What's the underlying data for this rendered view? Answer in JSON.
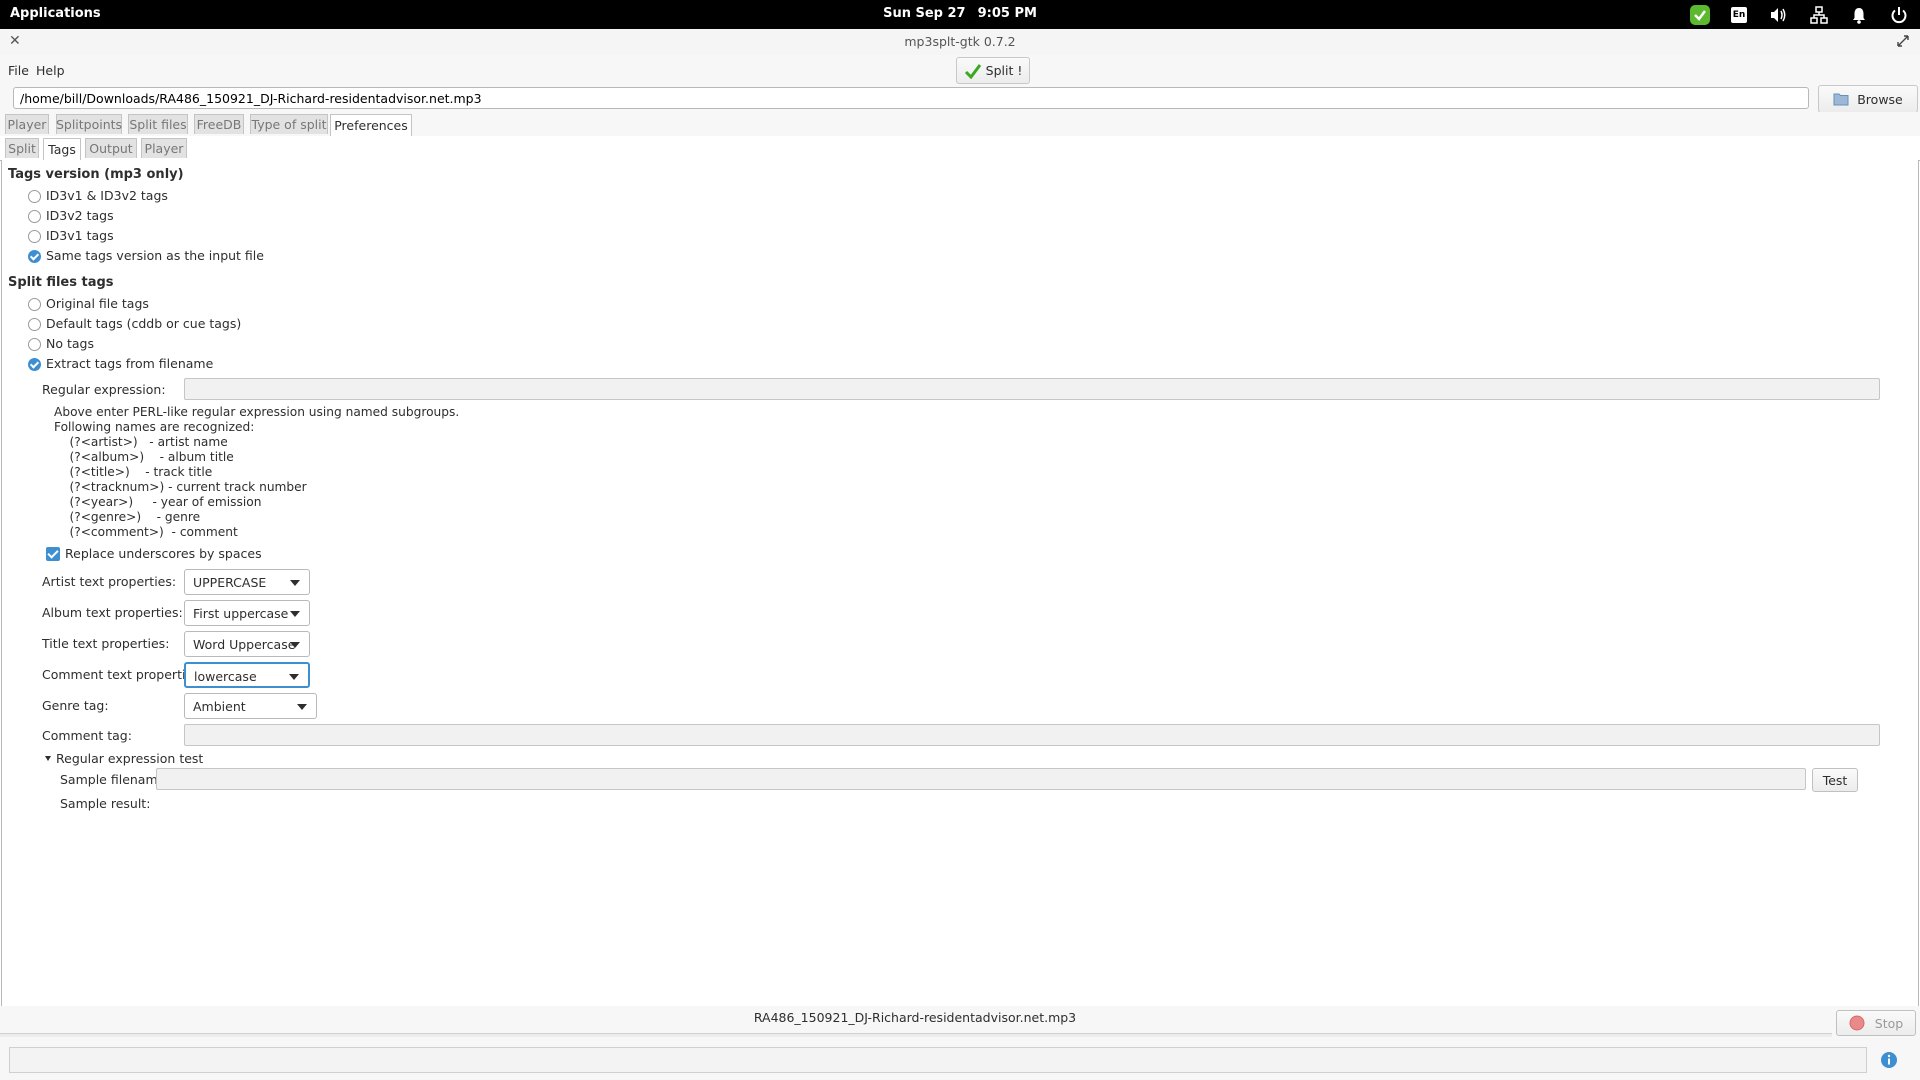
{
  "topbar": {
    "applications": "Applications",
    "date": "Sun Sep 27",
    "time": "9:05 PM",
    "keyboard": "En"
  },
  "window": {
    "title": "mp3splt-gtk 0.7.2"
  },
  "menu": {
    "file": "File",
    "help": "Help",
    "split_button": "Split !"
  },
  "path": {
    "value": "/home/bill/Downloads/RA486_150921_DJ-Richard-residentadvisor.net.mp3",
    "browse": "Browse"
  },
  "main_tabs": [
    "Player",
    "Splitpoints",
    "Split files",
    "FreeDB",
    "Type of split",
    "Preferences"
  ],
  "sub_tabs": [
    "Split",
    "Tags",
    "Output",
    "Player"
  ],
  "tags_version": {
    "heading": "Tags version (mp3 only)",
    "options": [
      "ID3v1 & ID3v2 tags",
      "ID3v2 tags",
      "ID3v1 tags",
      "Same tags version as the input file"
    ],
    "selected": 3
  },
  "split_tags": {
    "heading": "Split files tags",
    "options": [
      "Original file tags",
      "Default tags (cddb or cue tags)",
      "No tags",
      "Extract tags from filename"
    ],
    "selected": 3
  },
  "regex": {
    "label": "Regular expression:",
    "value": "",
    "help": [
      "Above enter PERL-like regular expression using named subgroups.",
      "Following names are recognized:",
      "    (?<artist>)   - artist name",
      "    (?<album>)    - album title",
      "    (?<title>)    - track title",
      "    (?<tracknum>) - current track number",
      "    (?<year>)     - year of emission",
      "    (?<genre>)    - genre",
      "    (?<comment>)  - comment"
    ]
  },
  "replace_underscores": {
    "label": "Replace underscores by spaces",
    "checked": true
  },
  "properties": {
    "artist_label": "Artist text properties:",
    "artist_value": "UPPERCASE",
    "album_label": "Album text properties:",
    "album_value": "First uppercase",
    "title_label": "Title text properties:",
    "title_value": "Word Uppercase",
    "comment_label": "Comment text properties:",
    "comment_value": "lowercase",
    "genre_label": "Genre tag:",
    "genre_value": "Ambient",
    "comment_tag_label": "Comment tag:",
    "comment_tag_value": ""
  },
  "regex_test": {
    "expander": "Regular expression test",
    "sample_filename_label": "Sample filename:",
    "sample_filename_value": "",
    "test_button": "Test",
    "sample_result_label": "Sample result:"
  },
  "status": {
    "filename": "RA486_150921_DJ-Richard-residentadvisor.net.mp3",
    "stop": "Stop",
    "message": ""
  },
  "colors": {
    "accent": "#3d8fd1",
    "topbar": "#000000",
    "check_green": "#5cb82e"
  }
}
